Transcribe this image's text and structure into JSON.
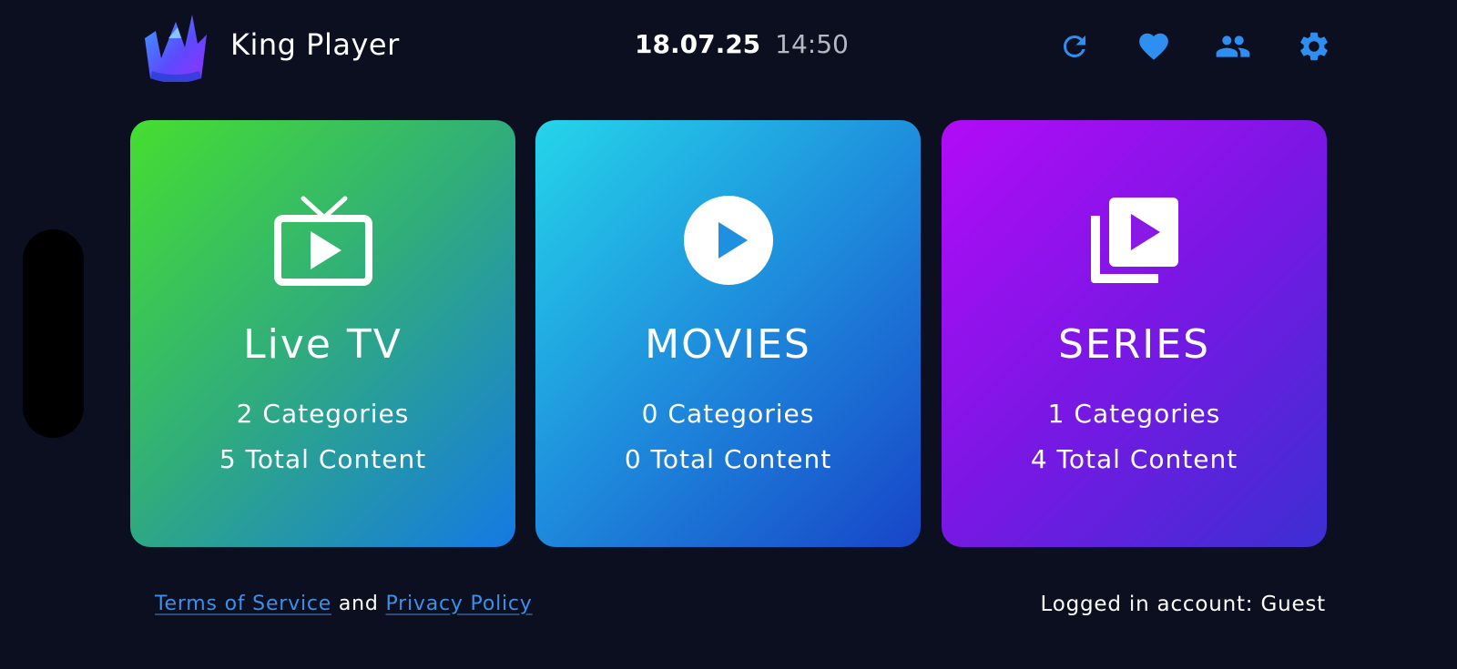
{
  "app": {
    "title": "King Player",
    "logo_icon": "crown-logo-icon"
  },
  "header": {
    "date": "18.07.25",
    "time": "14:50",
    "accent_color": "#2f8ff0",
    "actions": [
      {
        "icon": "refresh-icon"
      },
      {
        "icon": "heart-icon"
      },
      {
        "icon": "users-icon"
      },
      {
        "icon": "gear-icon"
      }
    ]
  },
  "cards": [
    {
      "title": "Live TV",
      "categories": "2 Categories",
      "total": "5 Total Content",
      "icon": "tv-play-icon",
      "gradient": [
        "#46de30",
        "#2fab7f",
        "#1479e4"
      ]
    },
    {
      "title": "MOVIES",
      "categories": "0 Categories",
      "total": "0 Total Content",
      "icon": "play-circle-icon",
      "gradient": [
        "#25d5ea",
        "#1e8cdc",
        "#1745c8"
      ]
    },
    {
      "title": "SERIES",
      "categories": "1 Categories",
      "total": "4 Total Content",
      "icon": "video-library-icon",
      "gradient": [
        "#b20bf7",
        "#7a17e4",
        "#3c2fd2"
      ]
    }
  ],
  "footer": {
    "terms_label": "Terms of Service",
    "and_text": "and",
    "privacy_label": "Privacy Policy",
    "account_text": "Logged in account: Guest",
    "link_color": "#3d8fe8"
  }
}
